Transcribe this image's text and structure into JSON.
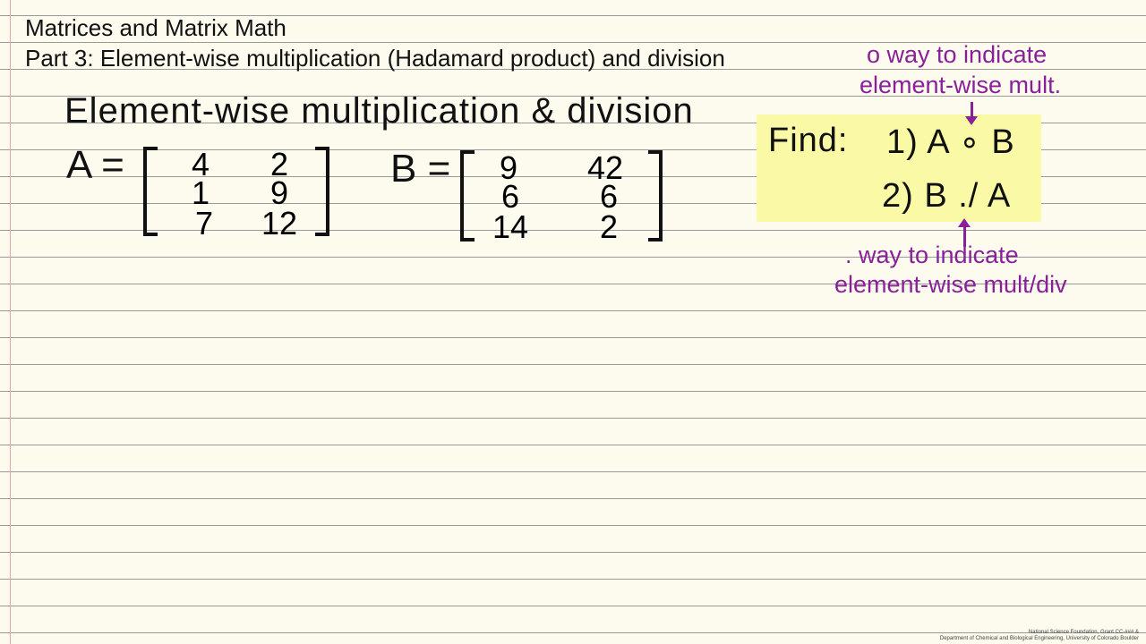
{
  "header": {
    "title": "Matrices and Matrix Math",
    "subtitle": "Part 3: Element-wise multiplication (Hadamard product) and division"
  },
  "board": {
    "heading": "Element-wise multiplication & division",
    "matrix_a": {
      "label": "A =",
      "rows": [
        [
          "4",
          "2"
        ],
        [
          "1",
          "9"
        ],
        [
          "7",
          "12"
        ]
      ]
    },
    "matrix_b": {
      "label": "B =",
      "rows": [
        [
          "9",
          "42"
        ],
        [
          "6",
          "6"
        ],
        [
          "14",
          "2"
        ]
      ]
    },
    "find": {
      "label": "Find:",
      "item1": "1)  A ∘ B",
      "item2": "2)  B ./ A"
    },
    "notes": {
      "note1_line1": "o way to indicate",
      "note1_line2": "element-wise mult.",
      "note2_line1": ". way to indicate",
      "note2_line2": "element-wise mult/div"
    },
    "colors": {
      "paper": "#fdfbee",
      "ink": "#111111",
      "highlight": "#fafaa6",
      "annotation": "#8a1f9a",
      "margin": "#e2a4a4"
    }
  },
  "credit": {
    "line1": "National Science Foundation, Grant CC-### &",
    "line2": "Department of Chemical and Biological Engineering, University of Colorado Boulder"
  }
}
